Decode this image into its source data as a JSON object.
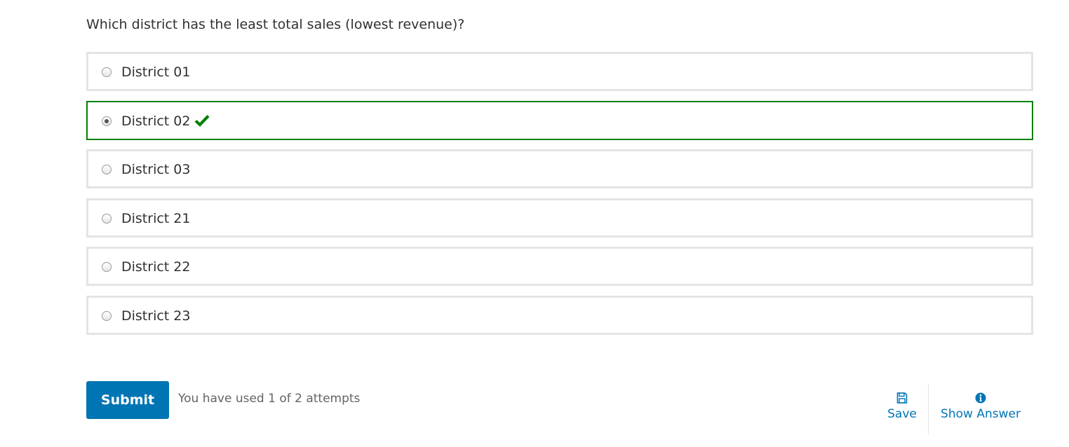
{
  "question": "Which district has the least total sales (lowest revenue)?",
  "choices": [
    {
      "label": "District 01",
      "selected": false,
      "correct": false
    },
    {
      "label": "District 02",
      "selected": true,
      "correct": true
    },
    {
      "label": "District 03",
      "selected": false,
      "correct": false
    },
    {
      "label": "District 21",
      "selected": false,
      "correct": false
    },
    {
      "label": "District 22",
      "selected": false,
      "correct": false
    },
    {
      "label": "District 23",
      "selected": false,
      "correct": false
    }
  ],
  "actions": {
    "submit_label": "Submit",
    "attempts_text": "You have used 1 of 2 attempts",
    "save_label": "Save",
    "save_icon": "floppy-disk-icon",
    "show_answer_label": "Show Answer",
    "show_answer_icon": "info-circle-icon"
  },
  "colors": {
    "accent": "#0075b4",
    "correct": "#008100",
    "border": "#e4e4e4",
    "text": "#313131",
    "muted": "#646464"
  }
}
